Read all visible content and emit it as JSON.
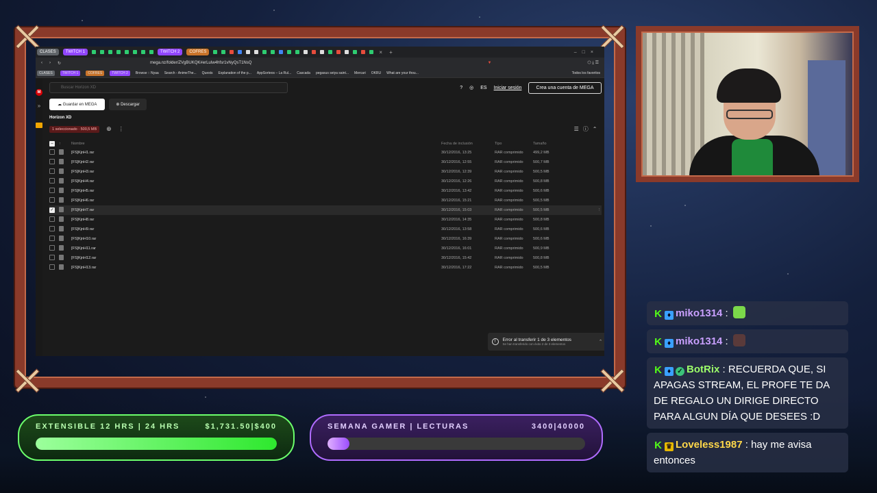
{
  "browser": {
    "tabs": [
      "CLASES",
      "TWITCH 1",
      "TWITCH 2",
      "COFRES"
    ],
    "url": "mega.nz/folder/ZVgBUKQK#erLuIw4hfsr1vNyQsT1NsQ",
    "bookmarks": [
      "CLASES",
      "TWITCH 1",
      "COFRES",
      "TWITCH 2",
      "Browse :: Nyaa",
      "Search - AnimeThe...",
      "Quests",
      "Explanation of the p...",
      "AppSorteos – La Rul...",
      "Cascada",
      "pegasus seiya saint...",
      "Mercari",
      "OKRU",
      "What are your thou...",
      "Todos los favoritos"
    ]
  },
  "mega": {
    "search_placeholder": "Buscar Horizon XD",
    "lang": "ES",
    "login_label": "Iniciar sesión",
    "create_label": "Crea una cuenta de MEGA",
    "save_label": "Guardar en MEGA",
    "download_label": "Descargar",
    "folder_name": "Horizon XD",
    "selection_text": "1 seleccionado",
    "selection_size": "500,5 MB",
    "columns": {
      "name": "Nombre",
      "date": "Fecha de inclusión",
      "type": "Tipo",
      "size": "Tamaño"
    },
    "files": [
      {
        "name": "[FS]KjnH1.rar",
        "date": "30/12/2016, 13:25",
        "type": "RAR comprimido",
        "size": "499,2 MB",
        "checked": false
      },
      {
        "name": "[FS]KjnH2.rar",
        "date": "30/12/2016, 12:55",
        "type": "RAR comprimido",
        "size": "500,7 MB",
        "checked": false
      },
      {
        "name": "[FS]KjnH3.rar",
        "date": "30/12/2016, 12:39",
        "type": "RAR comprimido",
        "size": "500,5 MB",
        "checked": false
      },
      {
        "name": "[FS]KjnH4.rar",
        "date": "30/12/2016, 12:26",
        "type": "RAR comprimido",
        "size": "500,8 MB",
        "checked": false
      },
      {
        "name": "[FS]KjnH5.rar",
        "date": "30/12/2016, 13:42",
        "type": "RAR comprimido",
        "size": "500,6 MB",
        "checked": false
      },
      {
        "name": "[FS]KjnH6.rar",
        "date": "30/12/2016, 15:21",
        "type": "RAR comprimido",
        "size": "500,5 MB",
        "checked": false
      },
      {
        "name": "[FS]KjnH7.rar",
        "date": "30/12/2016, 15:03",
        "type": "RAR comprimido",
        "size": "500,5 MB",
        "checked": true
      },
      {
        "name": "[FS]KjnH8.rar",
        "date": "30/12/2016, 14:35",
        "type": "RAR comprimido",
        "size": "500,8 MB",
        "checked": false
      },
      {
        "name": "[FS]KjnH9.rar",
        "date": "30/12/2016, 13:58",
        "type": "RAR comprimido",
        "size": "500,6 MB",
        "checked": false
      },
      {
        "name": "[FS]KjnH10.rar",
        "date": "30/12/2016, 16:39",
        "type": "RAR comprimido",
        "size": "500,6 MB",
        "checked": false
      },
      {
        "name": "[FS]KjnH11.rar",
        "date": "30/12/2016, 16:01",
        "type": "RAR comprimido",
        "size": "500,9 MB",
        "checked": false
      },
      {
        "name": "[FS]KjnH12.rar",
        "date": "30/12/2016, 15:42",
        "type": "RAR comprimido",
        "size": "500,8 MB",
        "checked": false
      },
      {
        "name": "[FS]KjnH13.rar",
        "date": "30/12/2016, 17:22",
        "type": "RAR comprimido",
        "size": "500,5 MB",
        "checked": false
      }
    ],
    "toast_title": "Error al transferir 1 de 3 elementos",
    "toast_sub": "Se han transferido con éxito 2 de 3 elementos"
  },
  "goals": {
    "left": {
      "label": "EXTENSIBLE 12 HRS | 24 HRS",
      "amount": "$1,731.50|$400",
      "progress": 1.0
    },
    "right": {
      "label": "SEMANA GAMER | LECTURAS",
      "amount": "3400|40000",
      "progress": 0.085
    }
  },
  "chat": [
    {
      "user": "miko1314",
      "text": "",
      "user_color": "#c9a0ff",
      "badges": [
        "kick",
        "prime"
      ],
      "emote_color": "#7bd84a"
    },
    {
      "user": "miko1314",
      "text": "",
      "user_color": "#c9a0ff",
      "badges": [
        "kick",
        "prime"
      ],
      "emote_color": "#5a3a3a"
    },
    {
      "user": "BotRix",
      "text": "RECUERDA QUE, SI APAGAS STREAM, EL PROFE TE DA DE REGALO UN DIRIGE DIRECTO PARA ALGUN DÍA QUE DESEES :D",
      "user_color": "#9dff6a",
      "badges": [
        "kick",
        "prime",
        "verified"
      ]
    },
    {
      "user": "Loveless1987",
      "text": "hay me avisa entonces",
      "user_color": "#ffd84a",
      "badges": [
        "kick",
        "crown"
      ]
    }
  ],
  "colors": {
    "mega_red": "#d90007",
    "goal_green": "#6cff6c",
    "goal_purple": "#b06cff"
  }
}
